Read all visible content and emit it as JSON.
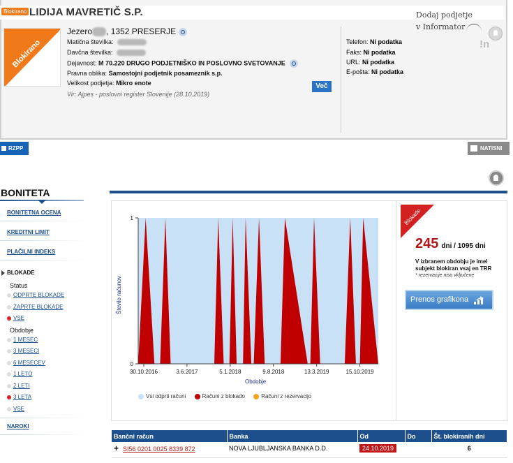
{
  "header": {
    "badge": "Blokirano",
    "company": "LIDIJA MAVRETIČ S.P.",
    "logo_badge": "Blokirano",
    "address_prefix": "Jezero",
    "address_suffix": ", 1352 PRESERJE",
    "maticna_label": "Matična številka:",
    "davcna_label": "Davčna številka:",
    "dejavnost_label": "Dejavnost:",
    "dejavnost_value": "M 70.220 DRUGO PODJETNIŠKO IN POSLOVNO SVETOVANJE",
    "pravna_label": "Pravna oblika:",
    "pravna_value": "Samostojni podjetnik posameznik s.p.",
    "velikost_label": "Velikost podjetja:",
    "velikost_value": "Mikro enote",
    "source": "Vir: Ajpes - poslovni register Slovenije (28.10.2019)",
    "more_button": "Več",
    "handwritten_line1": "Dodaj podjetje",
    "handwritten_line2": "v Informator",
    "info_logo": "!n",
    "contacts": [
      {
        "label": "Telefon:",
        "value": "Ni podatka"
      },
      {
        "label": "Faks:",
        "value": "Ni podatka"
      },
      {
        "label": "URL:",
        "value": "Ni podatka"
      },
      {
        "label": "E-pošta:",
        "value": "Ni podatka"
      }
    ]
  },
  "toolbar": {
    "rzpp": "RZPP",
    "natisni": "NATISNI"
  },
  "sidebar": {
    "title": "BONITETA",
    "links": [
      "BONITETNA OCENA",
      "KREDITNI LIMIT",
      "PLAČILNI INDEKS"
    ],
    "blokade_head": "BLOKADE",
    "status_label": "Status",
    "status_options": [
      "ODPRTE BLOKADE",
      "ZAPRTE BLOKADE",
      "VSE"
    ],
    "obdobje_label": "Obdobje",
    "obdobje_options": [
      "1 MESEC",
      "3 MESECI",
      "6 MESECEV",
      "1 LETO",
      "2 LETI",
      "3 LETA",
      "VSE"
    ],
    "naroki": "NAROKI"
  },
  "summary": {
    "badge": "Blokade",
    "days": "245",
    "days_text": "dni / 1095 dni",
    "note": "V izbranem obdobju je imel subjekt blokiran vsaj en TRR",
    "note2": "* rezervacije niso vključene",
    "download_button": "Prenos grafikona"
  },
  "chart_data": {
    "type": "area",
    "ylabel": "Število računov",
    "xlabel": "Obdobje",
    "ylim": [
      0,
      1
    ],
    "y_ticks": [
      "0",
      "1"
    ],
    "x_ticks": [
      "30.10.2016",
      "3.6.2017",
      "5.1.2018",
      "9.8.2018",
      "13.3.2019",
      "15.10.2019"
    ],
    "x_range": [
      "2016-10-28",
      "2019-10-28"
    ],
    "series": [
      {
        "name": "Vsi odprti računi",
        "color": "#c8e1f7",
        "values": "1 throughout period"
      },
      {
        "name": "Računi z blokado",
        "color": "#c00000",
        "peaks": [
          {
            "start": "2016-10-28",
            "peak": "2016-12-01",
            "end": "2017-01-10"
          },
          {
            "start": "2017-02-05",
            "peak": "2017-03-01",
            "end": "2017-03-25"
          },
          {
            "start": "2017-10-10",
            "peak": "2017-10-28",
            "end": "2017-11-22"
          },
          {
            "start": "2017-12-18",
            "peak": "2018-01-02",
            "end": "2018-01-20"
          },
          {
            "start": "2018-02-18",
            "peak": "2018-03-02",
            "end": "2018-03-28"
          },
          {
            "start": "2018-04-08",
            "peak": "2018-05-02",
            "end": "2018-05-28"
          },
          {
            "start": "2018-08-08",
            "peak": "2018-08-28",
            "end": "2018-12-10"
          },
          {
            "start": "2018-12-22",
            "peak": "2019-01-08",
            "end": "2019-02-05"
          },
          {
            "start": "2019-05-28",
            "peak": "2019-06-22",
            "end": "2019-07-18"
          },
          {
            "start": "2019-08-05",
            "peak": "2019-08-20",
            "end": "2019-10-28"
          }
        ]
      },
      {
        "name": "Računi z rezervacijo",
        "color": "#f2a524",
        "values": "0 throughout period"
      }
    ],
    "legend_position": "bottom"
  },
  "table": {
    "headers": [
      "Bančni račun",
      "Banka",
      "Od",
      "Do",
      "Št. blokiranih dni"
    ],
    "rows": [
      {
        "account": "SI56 0201 0025 8339 872",
        "bank": "NOVA LJUBLJANSKA BANKA D.D.",
        "from": "24.10.2019",
        "to": "",
        "days": "6"
      }
    ]
  }
}
